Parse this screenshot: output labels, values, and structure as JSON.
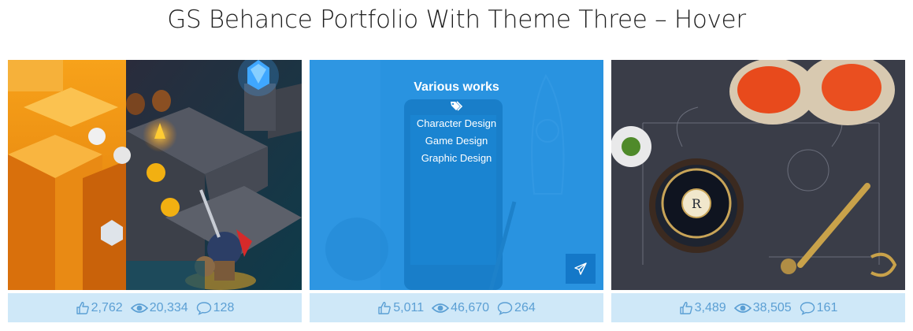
{
  "page": {
    "title": "GS Behance Portfolio With Theme Three – Hover"
  },
  "colors": {
    "accent": "#1a8fe0",
    "stats_bg": "#cfe8f8",
    "stats_text": "#5b9fd4"
  },
  "cards": [
    {
      "image": "isometric game level with knight",
      "stats": {
        "appreciations": "2,762",
        "views": "20,334",
        "comments": "128"
      }
    },
    {
      "image": "rocket sketch and phone",
      "hover": {
        "title": "Various works",
        "tag_icon": "tags-icon",
        "fields": [
          "Character Design",
          "Game Design",
          "Graphic Design"
        ],
        "link_icon": "paper-plane-icon"
      },
      "stats": {
        "appreciations": "5,011",
        "views": "46,670",
        "comments": "264"
      }
    },
    {
      "image": "royal crown caviar tin with oysters",
      "stats": {
        "appreciations": "3,489",
        "views": "38,505",
        "comments": "161"
      }
    }
  ]
}
